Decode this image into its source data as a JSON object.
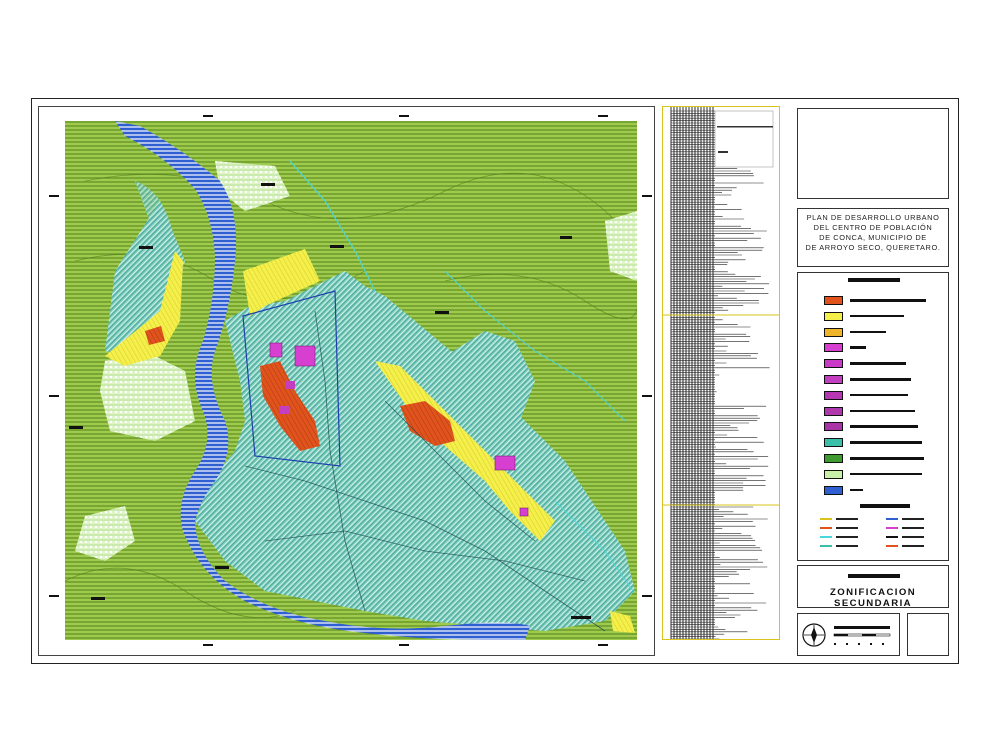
{
  "title_block": {
    "title_lines": [
      "PLAN DE DESARROLLO URBANO",
      "DEL CENTRO DE POBLACIÓN",
      "DE CONCA, MUNICIPIO DE",
      "DE ARROYO SECO, QUERETARO."
    ]
  },
  "sheet": {
    "name": "ZONIFICACION SECUNDARIA"
  },
  "legend": {
    "items": [
      {
        "color": "#e0531d",
        "icon": "zone-swatch-orange"
      },
      {
        "color": "#f4ef4a",
        "icon": "zone-swatch-yellow"
      },
      {
        "color": "#f0b428",
        "icon": "zone-swatch-amber"
      },
      {
        "color": "#d63fd0",
        "icon": "zone-swatch-magenta"
      },
      {
        "color": "#c93bc6",
        "icon": "zone-swatch-magenta"
      },
      {
        "color": "#c23fbf",
        "icon": "zone-swatch-magenta"
      },
      {
        "color": "#b637b3",
        "icon": "zone-swatch-magenta"
      },
      {
        "color": "#b038ad",
        "icon": "zone-swatch-magenta"
      },
      {
        "color": "#a834a5",
        "icon": "zone-swatch-magenta"
      },
      {
        "color": "#3bbfa9",
        "icon": "zone-swatch-teal"
      },
      {
        "color": "#3f9a2f",
        "icon": "zone-swatch-green"
      },
      {
        "color": "#c8f0a8",
        "icon": "zone-swatch-lightgreen"
      },
      {
        "color": "#2f5fd0",
        "icon": "zone-swatch-blue"
      }
    ]
  },
  "colors": {
    "agricultural": "#8cbf3a",
    "urban_hatch": "#58b6a6",
    "river": "#2f5fd0",
    "commercial": "#f4ef4a",
    "mixed_use": "#e0531d",
    "equipment": "#d63fd0",
    "open_space": "#c8f0a8",
    "schedule_border": "#d9c41c"
  }
}
